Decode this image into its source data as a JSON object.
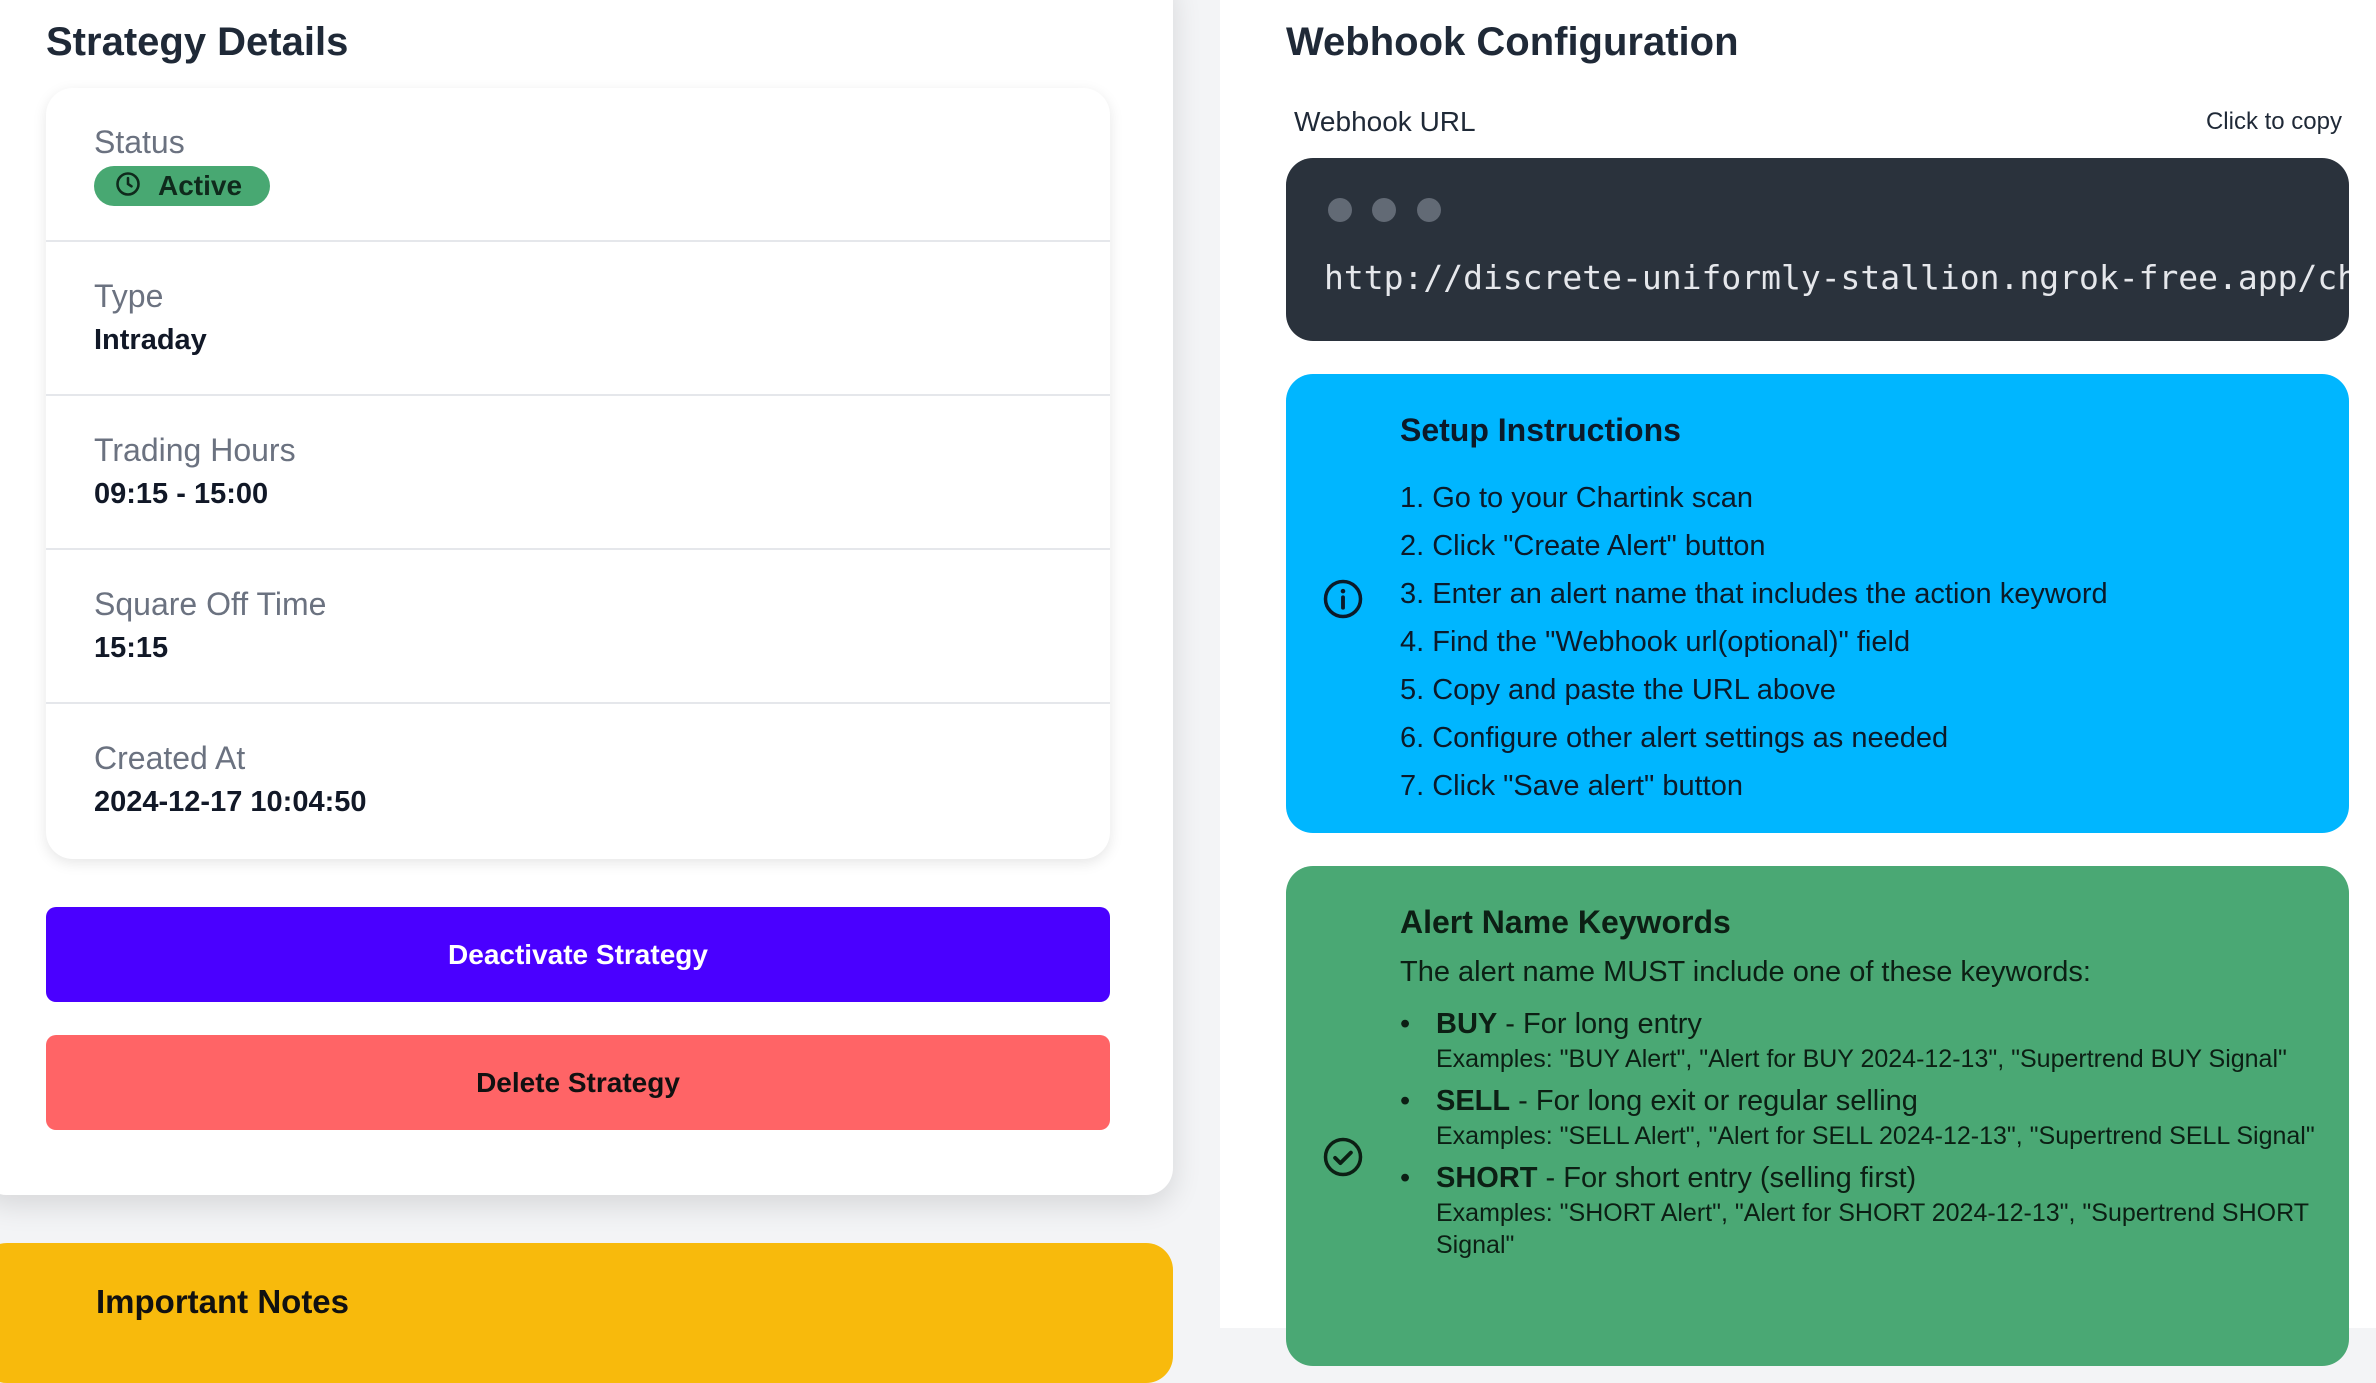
{
  "strategy_details": {
    "title": "Strategy Details",
    "status": {
      "label": "Status",
      "value": "Active",
      "color": "#48a872"
    },
    "type": {
      "label": "Type",
      "value": "Intraday"
    },
    "trading_hours": {
      "label": "Trading Hours",
      "value": "09:15 - 15:00"
    },
    "square_off": {
      "label": "Square Off Time",
      "value": "15:15"
    },
    "created_at": {
      "label": "Created At",
      "value": "2024-12-17 10:04:50"
    }
  },
  "actions": {
    "deactivate_label": "Deactivate Strategy",
    "deactivate_color": "#4a00ff",
    "delete_label": "Delete Strategy",
    "delete_color": "#ff6466"
  },
  "important_notes": {
    "title": "Important Notes",
    "color": "#f8ba0c"
  },
  "webhook": {
    "title": "Webhook Configuration",
    "url_label": "Webhook URL",
    "copy_hint": "Click to copy",
    "url": "http://discrete-uniformly-stallion.ngrok-free.app/cha"
  },
  "setup": {
    "title": "Setup Instructions",
    "icon": "info-circle-icon",
    "steps": [
      "1. Go to your Chartink scan",
      "2. Click \"Create Alert\" button",
      "3. Enter an alert name that includes the action keyword",
      "4. Find the \"Webhook url(optional)\" field",
      "5. Copy and paste the URL above",
      "6. Configure other alert settings as needed",
      "7. Click \"Save alert\" button"
    ]
  },
  "keywords": {
    "title": "Alert Name Keywords",
    "icon": "check-circle-icon",
    "intro": "The alert name MUST include one of these keywords:",
    "items": [
      {
        "keyword": "BUY",
        "desc": " - For long entry",
        "examples": "Examples: \"BUY Alert\", \"Alert for BUY 2024-12-13\", \"Supertrend BUY Signal\""
      },
      {
        "keyword": "SELL",
        "desc": " - For long exit or regular selling",
        "examples": "Examples: \"SELL Alert\", \"Alert for SELL 2024-12-13\", \"Supertrend SELL Signal\""
      },
      {
        "keyword": "SHORT",
        "desc": " - For short entry (selling first)",
        "examples": "Examples: \"SHORT Alert\", \"Alert for SHORT 2024-12-13\", \"Supertrend SHORT Signal\""
      }
    ]
  }
}
